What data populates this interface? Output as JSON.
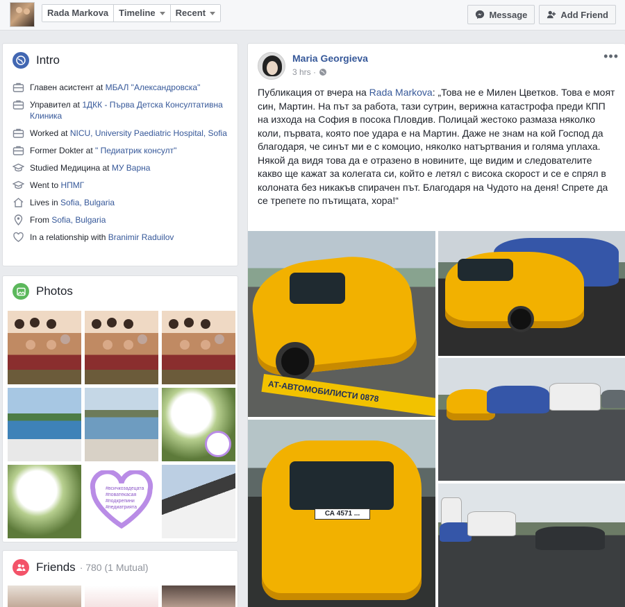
{
  "header": {
    "profile_name": "Rada Markova",
    "timeline_label": "Timeline",
    "recent_label": "Recent",
    "message_label": "Message",
    "add_friend_label": "Add Friend"
  },
  "intro": {
    "title": "Intro",
    "items": [
      {
        "icon": "briefcase-icon",
        "prefix": "Главен асистент at ",
        "link": "МБАЛ \"Александровска\"",
        "suffix": ""
      },
      {
        "icon": "briefcase-icon",
        "prefix": "Управител at ",
        "link": "1ДКК - Първа Детска Консултативна Клиника",
        "suffix": ""
      },
      {
        "icon": "briefcase-icon",
        "prefix": "Worked at ",
        "link": "NICU, University Paediatric Hospital, Sofia",
        "suffix": ""
      },
      {
        "icon": "briefcase-icon",
        "prefix": "Former Dokter at ",
        "link": "\" Педиатрик консулт\"",
        "suffix": ""
      },
      {
        "icon": "graduation-cap-icon",
        "prefix": "Studied Медицина at ",
        "link": "МУ Варна",
        "suffix": ""
      },
      {
        "icon": "graduation-cap-icon",
        "prefix": "Went to ",
        "link": "НПМГ",
        "suffix": ""
      },
      {
        "icon": "home-icon",
        "prefix": "Lives in ",
        "link": "Sofia, Bulgaria",
        "suffix": ""
      },
      {
        "icon": "map-pin-icon",
        "prefix": "From ",
        "link": "Sofia, Bulgaria",
        "suffix": ""
      },
      {
        "icon": "heart-icon",
        "prefix": "In a relationship with ",
        "link": "Branimir Raduilov",
        "suffix": ""
      }
    ]
  },
  "photos": {
    "title": "Photos",
    "heart_text": "#всичкозадецата\n#поватекасая\n#подкрепини\n#педиатрията"
  },
  "friends": {
    "title": "Friends",
    "count": "· 780 (1 Mutual)"
  },
  "post": {
    "author": "Maria Georgieva",
    "time": "3 hrs ·",
    "text_prefix": "Публикация от вчера на ",
    "text_link": "Rada Markova",
    "text_body": ": „Това не е Милен Цветков. Това е моят син, Мартин. На път за работа, тази сутрин, верижна катастрофа преди КПП на изхода на София в посока Пловдив. Полицай жестоко размаза няколко коли, първата, която пое удара е на Мартин. Даже не знам на кой Господ да благодаря, че синът ми е с комоцио, няколко натъртвания и голяма уплаха. Някой да видя това да е отразено в новините, ще видим и следователите какво ще кажат за колегата си, който е летял с висока скорост и се е спрял в колоната без никакъв спирачен път. Благодаря на Чудото на деня! Спрете да се трепете по пътищата, хора!“",
    "truck_text": "АТ-АВТОМОБИЛИСТИ 0878",
    "plate_text": "СА 4571 ..."
  },
  "colors": {
    "link": "#365899",
    "intro_icon": "#4267b2",
    "photos_icon": "#5cb85c",
    "friends_icon": "#f35369"
  }
}
